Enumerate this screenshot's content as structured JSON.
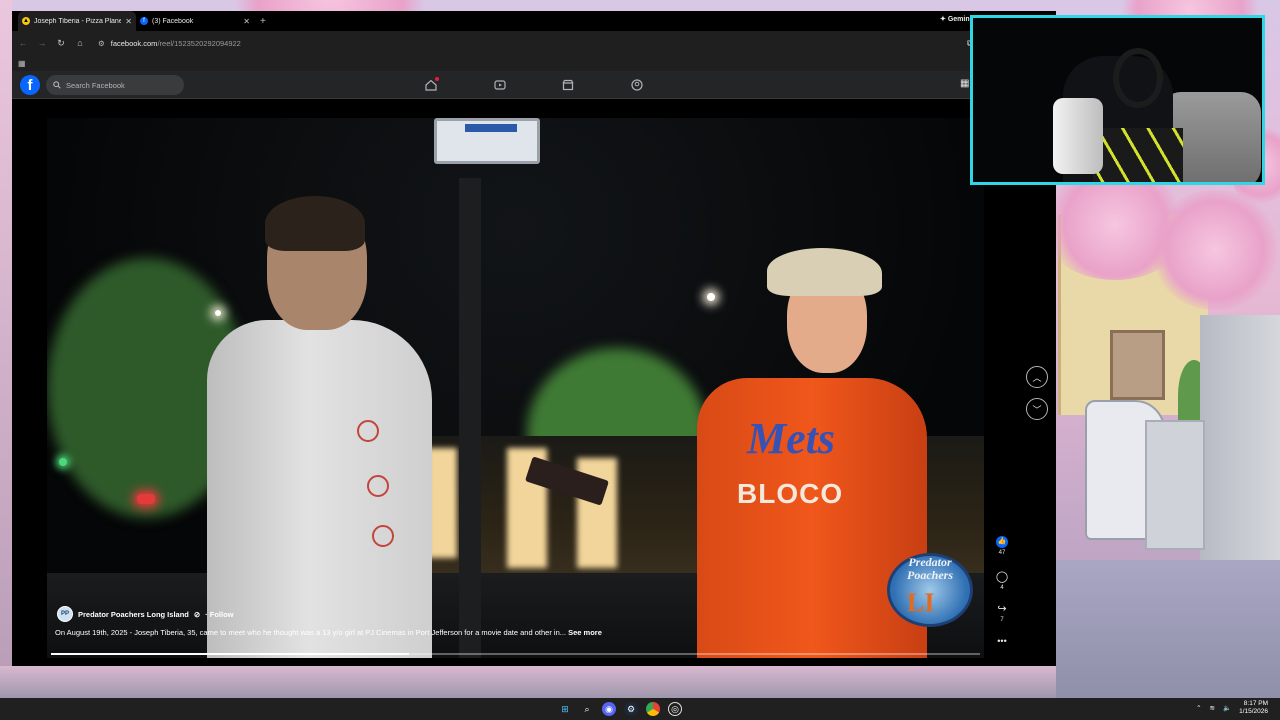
{
  "browser": {
    "tabs": [
      {
        "title": "Joseph Tiberia - Pizza Planet Pi",
        "active": true,
        "favicon_color": "#f5c518"
      },
      {
        "title": "(3) Facebook",
        "active": false,
        "favicon_color": "#0866ff"
      }
    ],
    "gemini_label": "Gemini",
    "url_host": "facebook.com",
    "url_path": "/reel/1523520292094922"
  },
  "facebook": {
    "logo_letter": "f",
    "search_placeholder": "Search Facebook",
    "nav_icons": [
      "home-icon",
      "video-icon",
      "marketplace-icon",
      "groups-icon"
    ]
  },
  "reel": {
    "author": "Predator Poachers Long Island",
    "verified_glyph": "⊘",
    "follow_label": "· Follow",
    "caption": "On August 19th, 2025 - Joseph Tiberia, 35, came to meet who he thought was a 13 y/o girl at PJ Cinemas in Port Jefferson for a movie date and other in...",
    "see_more": "See more",
    "progress_fraction": 0.385,
    "likes": "47",
    "comments": "4",
    "shares": "7",
    "watermark_line1": "Predator",
    "watermark_line2": "Poachers",
    "watermark_li": "LI",
    "shirt_text": "Mets",
    "shirt_sub": "BLOCO"
  },
  "taskbar": {
    "time": "8:17 PM",
    "date": "1/15/2026"
  },
  "colors": {
    "accent_webcam_border": "#2fd6e6",
    "facebook_blue": "#0866ff",
    "notification_red": "#e41e3f"
  }
}
